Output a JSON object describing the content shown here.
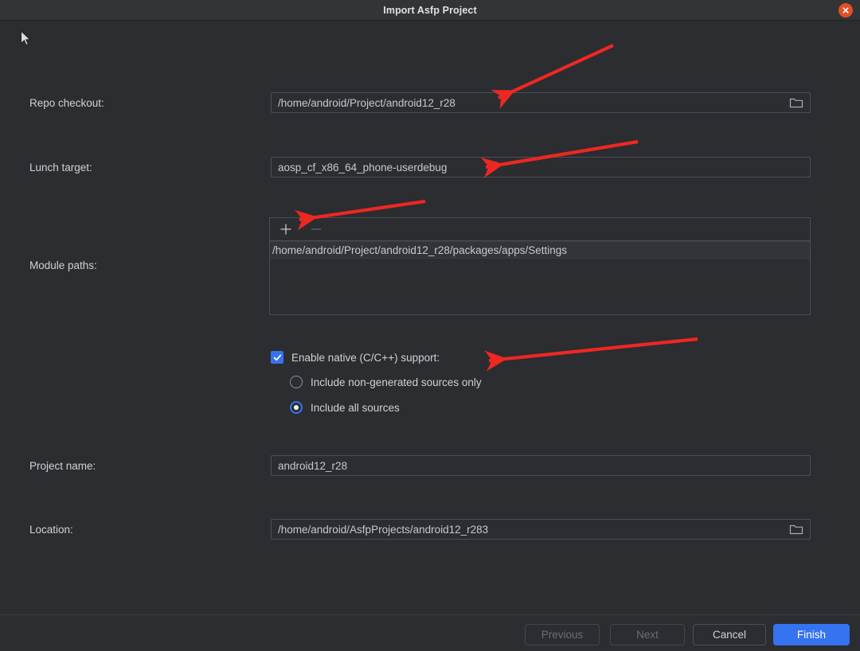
{
  "window": {
    "title": "Import Asfp Project",
    "close_icon": "close-icon",
    "accent_color": "#3573f0",
    "close_color": "#e24f27",
    "background_color": "#2b2d30"
  },
  "form": {
    "repo_checkout": {
      "label": "Repo checkout:",
      "value": "/home/android/Project/android12_r28",
      "browse_icon": "folder-icon"
    },
    "lunch_target": {
      "label": "Lunch target:",
      "value": "aosp_cf_x86_64_phone-userdebug"
    },
    "module_paths": {
      "label": "Module paths:",
      "add_label": "+",
      "remove_label": "−",
      "items": [
        "/home/android/Project/android12_r28/packages/apps/Settings"
      ]
    },
    "native_support": {
      "label": "Enable native (C/C++) support:",
      "checked": true,
      "options": [
        {
          "label": "Include non-generated sources only",
          "selected": false
        },
        {
          "label": "Include all sources",
          "selected": true
        }
      ]
    },
    "project_name": {
      "label": "Project name:",
      "value": "android12_r28"
    },
    "location": {
      "label": "Location:",
      "value": "/home/android/AsfpProjects/android12_r283",
      "browse_icon": "folder-icon"
    }
  },
  "footer": {
    "previous_label": "Previous",
    "next_label": "Next",
    "cancel_label": "Cancel",
    "finish_label": "Finish"
  },
  "annotations": {
    "color": "#ee2722",
    "arrow_count": 4
  }
}
